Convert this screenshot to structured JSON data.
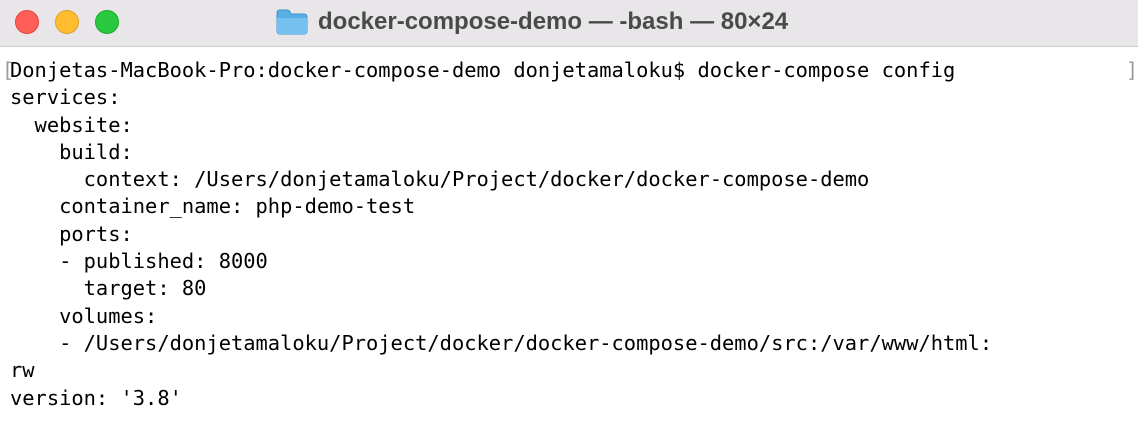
{
  "window": {
    "title": "docker-compose-demo — -bash — 80×24",
    "colors": {
      "close": "#ff5f57",
      "minimize": "#febc2e",
      "zoom": "#28c840",
      "titlebar": "#e8e6e8",
      "terminal_bg": "#ffffff",
      "text": "#000000"
    },
    "icon": "folder-icon"
  },
  "terminal": {
    "prompt": "Donjetas-MacBook-Pro:docker-compose-demo donjetamaloku$ docker-compose config",
    "output": [
      "services:",
      "  website:",
      "    build:",
      "      context: /Users/donjetamaloku/Project/docker/docker-compose-demo",
      "    container_name: php-demo-test",
      "    ports:",
      "    - published: 8000",
      "      target: 80",
      "    volumes:",
      "    - /Users/donjetamaloku/Project/docker/docker-compose-demo/src:/var/www/html:",
      "rw",
      "version: '3.8'"
    ]
  }
}
